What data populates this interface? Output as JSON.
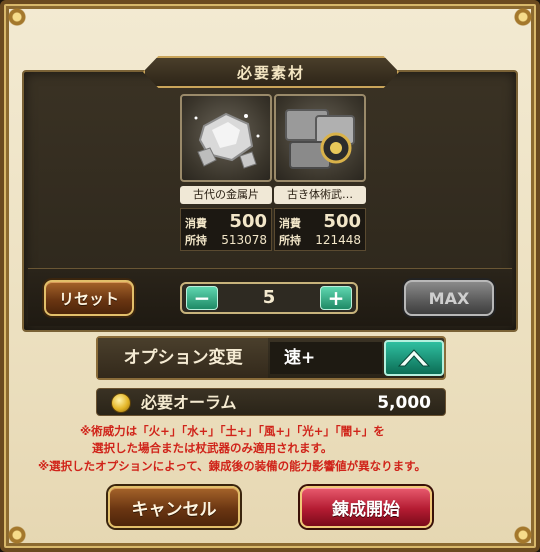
{
  "header": {
    "title": "必要素材"
  },
  "materials": [
    {
      "name": "古代の金属片",
      "consume_label": "消費",
      "consume": "500",
      "owned_label": "所持",
      "owned": "513078",
      "icon": "silver-ore-icon"
    },
    {
      "name": "古き体術武…",
      "consume_label": "消費",
      "consume": "500",
      "owned_label": "所持",
      "owned": "121448",
      "icon": "weapon-fragment-icon"
    }
  ],
  "controls": {
    "reset_label": "リセット",
    "quantity": "5",
    "minus_symbol": "−",
    "plus_symbol": "+",
    "max_label": "MAX"
  },
  "option": {
    "label": "オプション変更",
    "value": "速+"
  },
  "aurum": {
    "label": "必要オーラム",
    "value": "5,000"
  },
  "notes": [
    "※術威力は「火+」「水+」「土+」「風+」「光+」「闇+」を",
    "選択した場合または杖武器のみ適用されます。",
    "※選択したオプションによって、錬成後の装備の能力影響値が異なります。"
  ],
  "actions": {
    "cancel_label": "キャンセル",
    "start_label": "錬成開始"
  },
  "colors": {
    "accent_teal": "#1f8a66",
    "note_red": "#d0241a",
    "gold_border": "#e2bf6a"
  }
}
